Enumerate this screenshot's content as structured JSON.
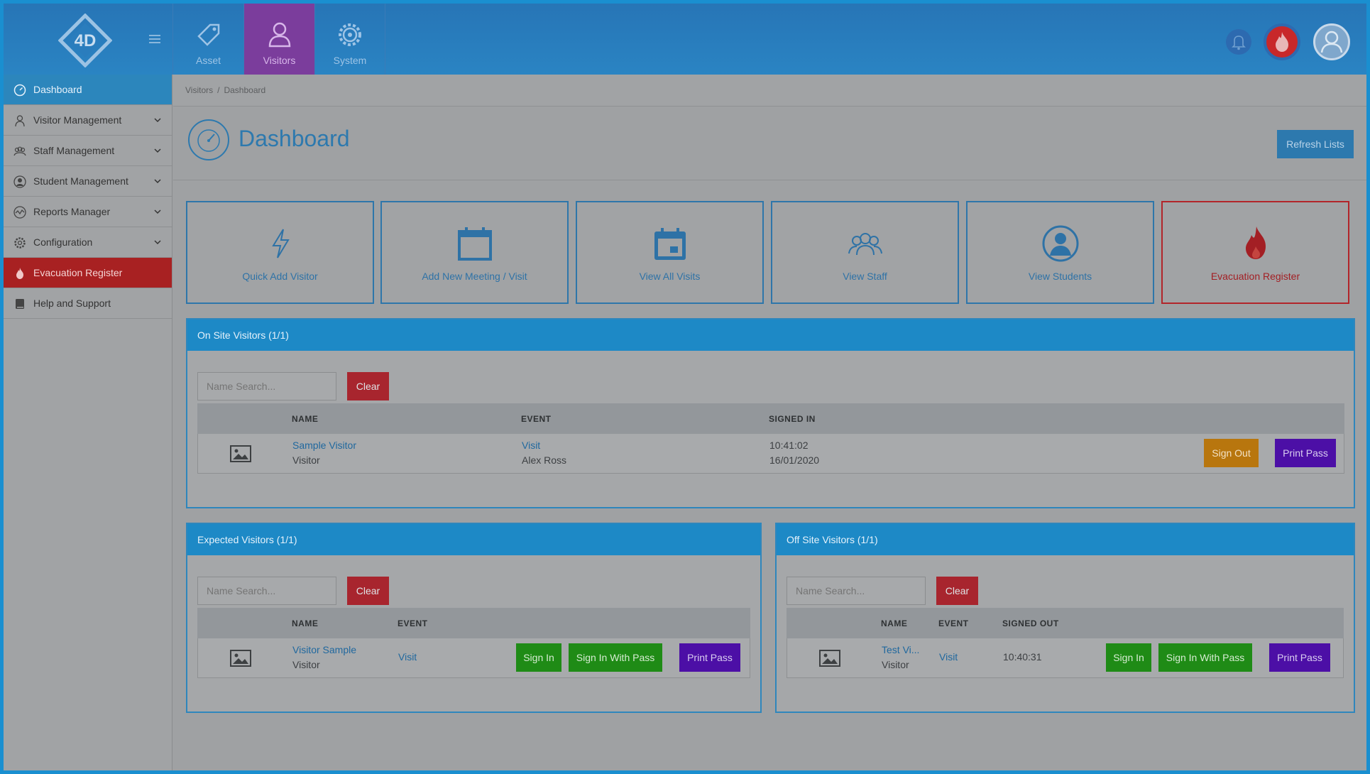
{
  "modules": [
    {
      "label": "Asset",
      "icon": "tag-icon"
    },
    {
      "label": "Visitors",
      "icon": "person-icon"
    },
    {
      "label": "System",
      "icon": "gear-icon"
    }
  ],
  "sidebar": {
    "items": [
      {
        "label": "Dashboard",
        "icon": "speedometer-icon"
      },
      {
        "label": "Visitor Management",
        "icon": "person-icon"
      },
      {
        "label": "Staff Management",
        "icon": "group-icon"
      },
      {
        "label": "Student Management",
        "icon": "student-icon"
      },
      {
        "label": "Reports Manager",
        "icon": "chart-icon"
      },
      {
        "label": "Configuration",
        "icon": "gear-icon"
      },
      {
        "label": "Evacuation Register",
        "icon": "flame-icon"
      },
      {
        "label": "Help and Support",
        "icon": "book-icon"
      }
    ]
  },
  "breadcrumb": {
    "parent": "Visitors",
    "separator": "/",
    "current": "Dashboard"
  },
  "page": {
    "title": "Dashboard",
    "refresh_label": "Refresh Lists"
  },
  "tiles": [
    {
      "label": "Quick Add Visitor",
      "icon": "lightning-icon"
    },
    {
      "label": "Add New Meeting / Visit",
      "icon": "calendar-icon"
    },
    {
      "label": "View All Visits",
      "icon": "calendar-event-icon"
    },
    {
      "label": "View Staff",
      "icon": "group-icon"
    },
    {
      "label": "View Students",
      "icon": "student-icon"
    },
    {
      "label": "Evacuation Register",
      "icon": "flame-icon"
    }
  ],
  "onsite": {
    "title": "On Site Visitors (1/1)",
    "search_placeholder": "Name Search...",
    "clear_label": "Clear",
    "columns": [
      "NAME",
      "EVENT",
      "SIGNED IN"
    ],
    "row": {
      "name": "Sample Visitor",
      "type": "Visitor",
      "event": "Visit",
      "host": "Alex Ross",
      "time": "10:41:02",
      "date": "16/01/2020",
      "signout_label": "Sign Out",
      "print_label": "Print Pass"
    }
  },
  "expected": {
    "title": "Expected Visitors (1/1)",
    "search_placeholder": "Name Search...",
    "clear_label": "Clear",
    "columns": [
      "NAME",
      "EVENT"
    ],
    "row": {
      "name": "Visitor Sample",
      "type": "Visitor",
      "event": "Visit",
      "signin_label": "Sign In",
      "signin_pass_label": "Sign In With Pass",
      "print_label": "Print Pass"
    }
  },
  "offsite": {
    "title": "Off Site Visitors (1/1)",
    "search_placeholder": "Name Search...",
    "clear_label": "Clear",
    "columns": [
      "NAME",
      "EVENT",
      "SIGNED OUT"
    ],
    "row": {
      "name": "Test Vi...",
      "type": "Visitor",
      "event": "Visit",
      "time": "10:40:31",
      "signin_label": "Sign In",
      "signin_pass_label": "Sign In With Pass",
      "print_label": "Print Pass"
    }
  },
  "colors": {
    "brand": "#2a84c3",
    "visitors_module": "#7b3d9c",
    "evacuation": "#a82122",
    "panel_header": "#1d89c6"
  }
}
